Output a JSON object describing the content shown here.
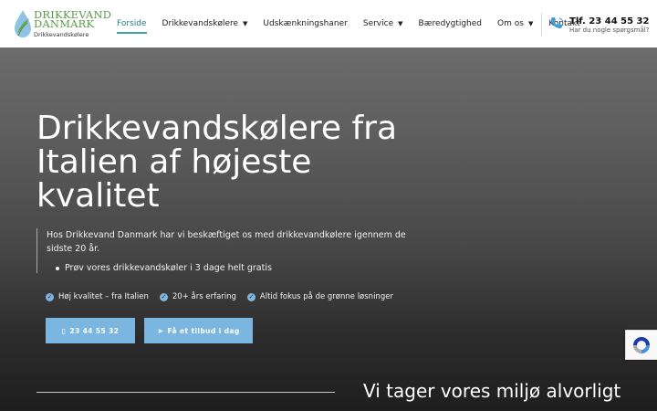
{
  "logo": {
    "line1": "DRIKKEVAND",
    "line2": "DANMARK",
    "line3": "Drikkevandskølere"
  },
  "nav": {
    "items": [
      {
        "label": "Forside",
        "active": true,
        "dropdown": false
      },
      {
        "label": "Drikkevandskølere",
        "active": false,
        "dropdown": true
      },
      {
        "label": "Udskænkningshaner",
        "active": false,
        "dropdown": false
      },
      {
        "label": "Service",
        "active": false,
        "dropdown": true
      },
      {
        "label": "Bæredygtighed",
        "active": false,
        "dropdown": false
      },
      {
        "label": "Om os",
        "active": false,
        "dropdown": true
      },
      {
        "label": "Kontakt",
        "active": false,
        "dropdown": false
      }
    ]
  },
  "contact": {
    "phone": "Tlf. 23 44 55 32",
    "subtitle": "Har du nogle spørgsmål?",
    "icon": "phone-ringing-icon"
  },
  "hero": {
    "title": "Drikkevandskølere fra Italien af højeste kvalitet",
    "description": "Hos Drikkevand Danmark har vi beskæftiget os med drikkevandkølere igennem de sidste 20 år.",
    "bullet": "Prøv vores drikkevandskøler i 3 dage helt gratis",
    "features": [
      "Høj kvalitet – fra Italien",
      "20+ års erfaring",
      "Altid fokus på de grønne løsninger"
    ],
    "buttons": {
      "call": "23 44 55 32",
      "offer": "Få et tilbud i dag"
    }
  },
  "section": {
    "title": "Vi tager vores miljø alvorligt"
  },
  "colors": {
    "brand_green": "#5c9a4a",
    "nav_active": "#3fa99f",
    "accent_blue": "#7ab6df",
    "phone_blue": "#3aa1d8"
  }
}
